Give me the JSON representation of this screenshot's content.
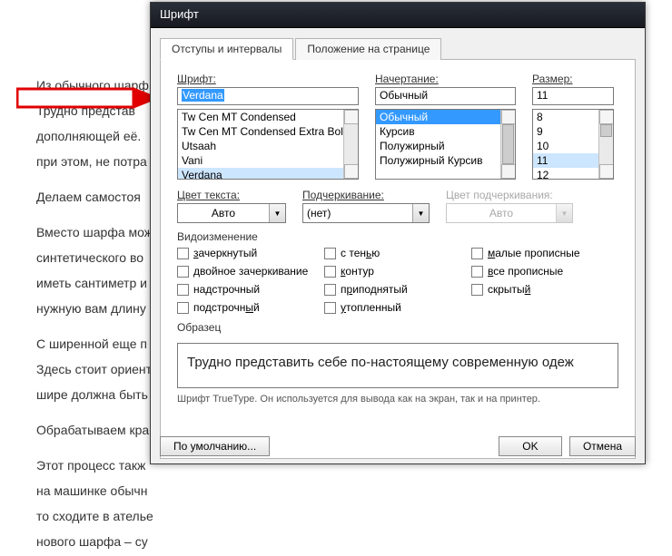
{
  "bg_paragraphs": [
    "Из обычного шарф",
    "Трудно представ",
    "дополняющей её.",
    "при этом, не потра",
    "Делаем самостоя",
    "Вместо шарфа мож",
    "синтетического во",
    "иметь сантиметр и",
    "нужную вам длину",
    " С ширенной еще п",
    "Здесь стоит ориент",
    "шире должна быть",
    "Обрабатываем кра",
    "Этот процесс такж",
    "на машинке обычн",
    "то сходите в ателье",
    "нового шарфа – су"
  ],
  "dialog_title": "Шрифт",
  "tabs": {
    "indents": "Отступы и интервалы",
    "position": "Положение на странице"
  },
  "font": {
    "label": "Шрифт:",
    "value": "Verdana",
    "options": [
      "Tw Cen MT Condensed",
      "Tw Cen MT Condensed Extra Bold",
      "Utsaah",
      "Vani",
      "Verdana"
    ]
  },
  "style": {
    "label": "Начертание:",
    "value": "Обычный",
    "options": [
      "Обычный",
      "Курсив",
      "Полужирный",
      "Полужирный Курсив"
    ]
  },
  "size": {
    "label": "Размер:",
    "value": "11",
    "options": [
      "8",
      "9",
      "10",
      "11",
      "12"
    ]
  },
  "color": {
    "label": "Цвет текста:",
    "value": "Авто"
  },
  "underline": {
    "label": "Подчеркивание:",
    "value": "(нет)"
  },
  "ulcolor": {
    "label": "Цвет подчеркивания:",
    "value": "Авто"
  },
  "effects": {
    "label": "Видоизменение",
    "col1": [
      "зачеркнутый",
      "двойное зачеркивание",
      "надстрочный",
      "подстрочный"
    ],
    "col2": [
      "с тенью",
      "контур",
      "приподнятый",
      "утопленный"
    ],
    "col3": [
      "малые прописные",
      "все прописные",
      "скрытый"
    ]
  },
  "sample": {
    "label": "Образец",
    "text": "Трудно представить себе по-настоящему современную одеж"
  },
  "hint": "Шрифт TrueType. Он используется для вывода как на экран, так и на принтер.",
  "buttons": {
    "default": "По умолчанию...",
    "ok": "OK",
    "cancel": "Отмена"
  }
}
